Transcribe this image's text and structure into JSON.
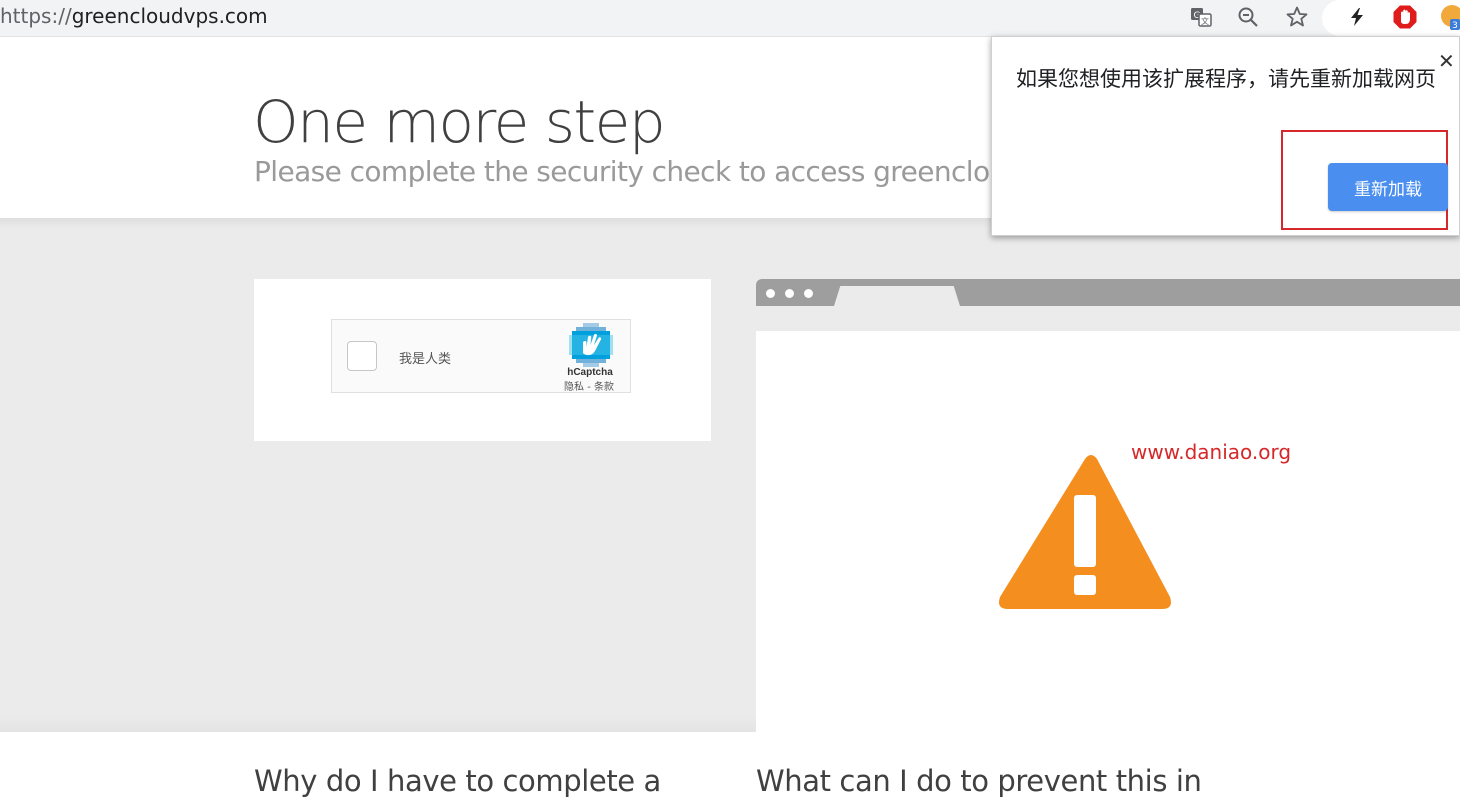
{
  "browser": {
    "url_scheme": "https://",
    "url_host": "greencloudvps.com",
    "toolbar_icons": [
      "translate-icon",
      "zoom-out-icon",
      "bookmark-star-icon",
      "lightning-extension-icon",
      "adblock-stop-icon",
      "extension-badge-icon"
    ],
    "extension_badge_count": "3"
  },
  "header": {
    "title": "One more step",
    "subtitle": "Please complete the security check to access greencloudvp"
  },
  "captcha": {
    "checkbox_label": "我是人类",
    "brand": "hCaptcha",
    "links": "隐私 - 条款"
  },
  "illustration": {
    "watermark": "www.daniao.org",
    "warning_color": "#f48e1f"
  },
  "questions": {
    "left": "Why do I have to complete a",
    "right": "What can I do to prevent this in"
  },
  "popup": {
    "message": "如果您想使用该扩展程序，请先重新加载网页",
    "close_label": "✕",
    "reload_button": "重新加载",
    "highlight_color": "#d6282a"
  }
}
